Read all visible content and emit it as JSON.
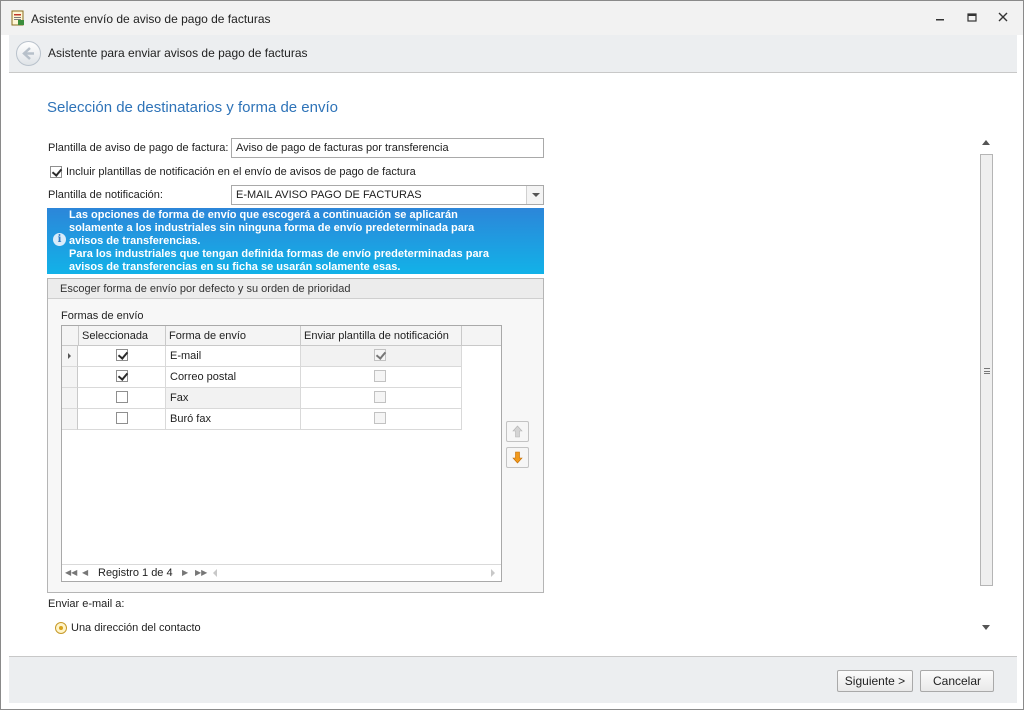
{
  "window": {
    "title": "Asistente envío de aviso de pago de facturas",
    "minimize_icon": "minimize-icon",
    "maximize_icon": "restore-icon",
    "close_icon": "close-icon"
  },
  "header": {
    "title": "Asistente para enviar avisos de pago de facturas",
    "back_icon": "back-arrow-icon"
  },
  "main": {
    "section_title": "Selección de destinatarios y forma de envío",
    "template_label": "Plantilla de aviso de pago de factura:",
    "template_value": "Aviso de pago de facturas por transferencia",
    "include_notifications_label": "Incluir plantillas de notificación en el envío de avisos de pago de factura",
    "include_notifications_checked": true,
    "notification_template_label": "Plantilla de notificación:",
    "notification_template_value": "E-MAIL AVISO PAGO DE FACTURAS",
    "info_lines": [
      "Las opciones de forma de envío que escogerá a continuación se aplicarán",
      "solamente a los industriales sin ninguna forma de envío predeterminada para",
      "avisos de transferencias.",
      "Para los industriales que tengan definida formas de envío predeterminadas para",
      "avisos de transferencias en su ficha se usarán solamente esas."
    ],
    "group_title": "Escoger forma de envío por defecto y su orden de prioridad",
    "grid_label": "Formas de envío",
    "grid": {
      "columns": [
        "Seleccionada",
        "Forma de envío",
        "Enviar plantilla de notificación"
      ],
      "rows": [
        {
          "selected": true,
          "method": "E-mail",
          "send_template": true
        },
        {
          "selected": true,
          "method": "Correo postal",
          "send_template": false
        },
        {
          "selected": false,
          "method": "Fax",
          "send_template": false
        },
        {
          "selected": false,
          "method": "Buró fax",
          "send_template": false
        }
      ],
      "navigator_text": "Registro 1 de 4"
    },
    "send_email_label": "Enviar e-mail a:",
    "radio_option_label": "Una dirección del contacto"
  },
  "footer": {
    "next_label": "Siguiente >",
    "cancel_label": "Cancelar"
  }
}
